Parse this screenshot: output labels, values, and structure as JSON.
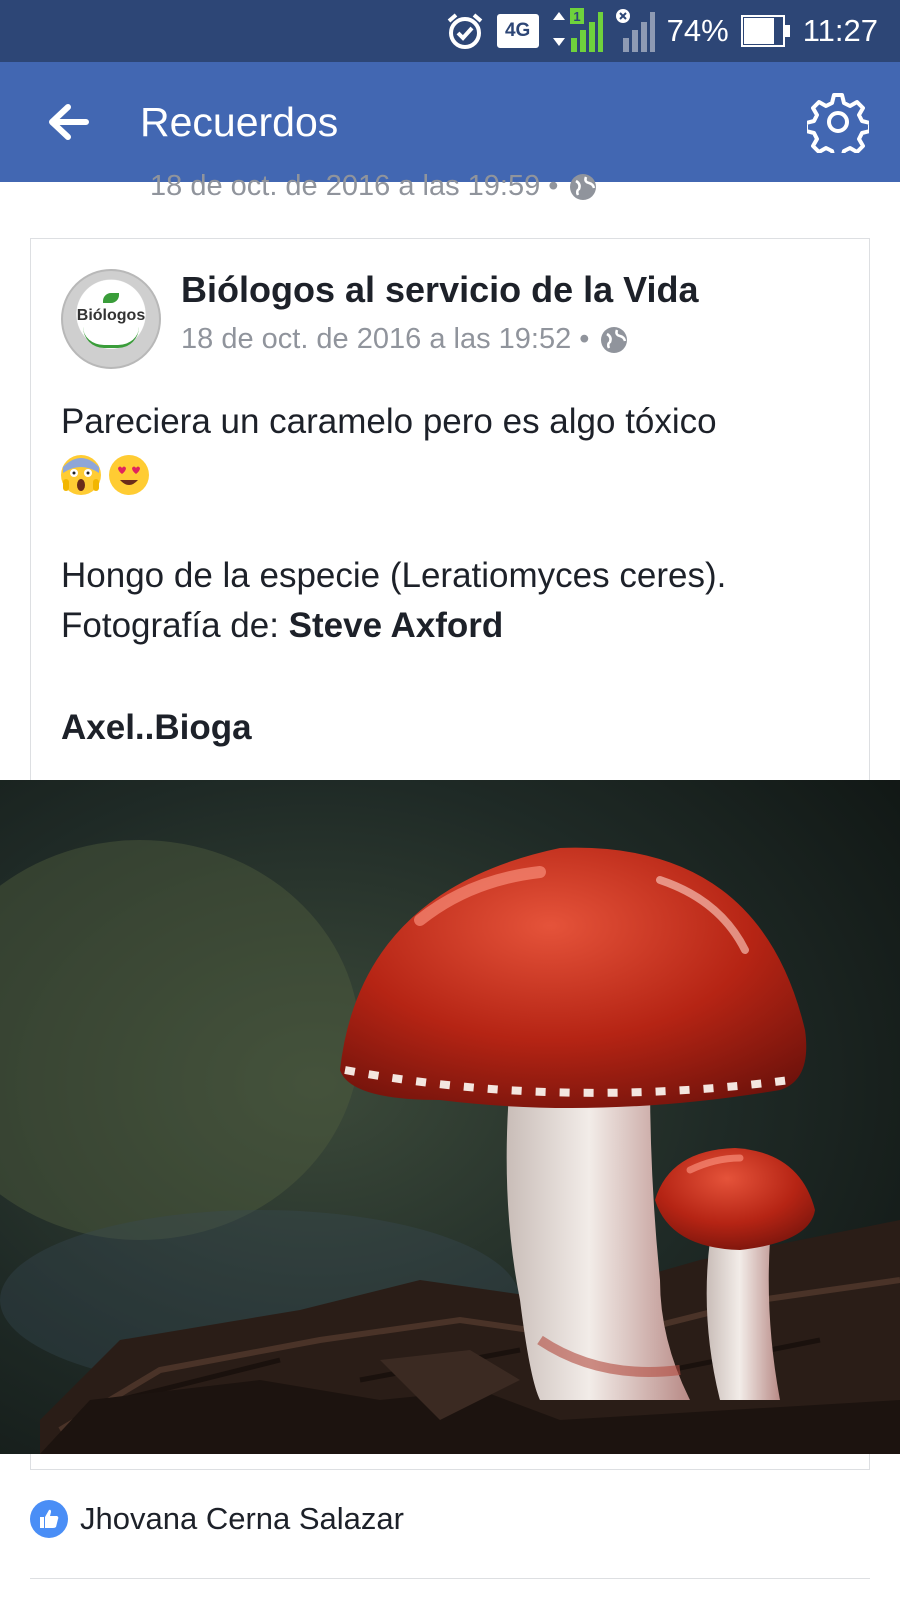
{
  "status_bar": {
    "network": "4G",
    "signal_badge": "1",
    "battery": "74%",
    "time": "11:27",
    "icons": [
      "alarm-icon",
      "signal-icon",
      "no-signal-icon",
      "battery-icon"
    ]
  },
  "top_bar": {
    "title": "Recuerdos",
    "back_icon": "arrow-left-icon",
    "settings_icon": "gear-icon",
    "background": "#4267b2"
  },
  "previous_post": {
    "timestamp": "18 de oct. de 2016 a las 19:59 •",
    "privacy_icon": "globe-icon"
  },
  "post": {
    "author": "Biólogos al servicio de la Vida",
    "avatar_text": "Biólogos",
    "timestamp": "18 de oct. de 2016 a las 19:52 •",
    "privacy_icon": "globe-icon",
    "text_line1": "Pareciera un caramelo pero es algo tóxico",
    "emojis": [
      "scream-emoji-icon",
      "heart-eyes-emoji-icon"
    ],
    "text_line2": "Hongo de la especie (Leratiomyces ceres).",
    "credit_prefix": "Fotografía de: ",
    "credit_name": "Steve Axford",
    "signature": "Axel..Bioga",
    "photo_subject": "red-mushroom-photo"
  },
  "reactions": {
    "icon": "like-icon",
    "names": "Jhovana Cerna Salazar"
  }
}
